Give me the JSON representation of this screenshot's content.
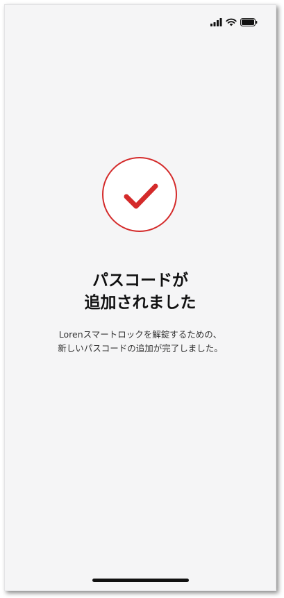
{
  "status_bar": {
    "signal_icon": "cellular-signal-icon",
    "wifi_icon": "wifi-icon",
    "battery_icon": "battery-icon"
  },
  "success": {
    "icon": "checkmark-icon",
    "accent_color": "#d42a2a",
    "title_line1": "パスコードが",
    "title_line2": "追加されました",
    "message_line1": "Lorenスマートロックを解錠するための、",
    "message_line2": "新しいパスコードの追加が完了しました。"
  }
}
